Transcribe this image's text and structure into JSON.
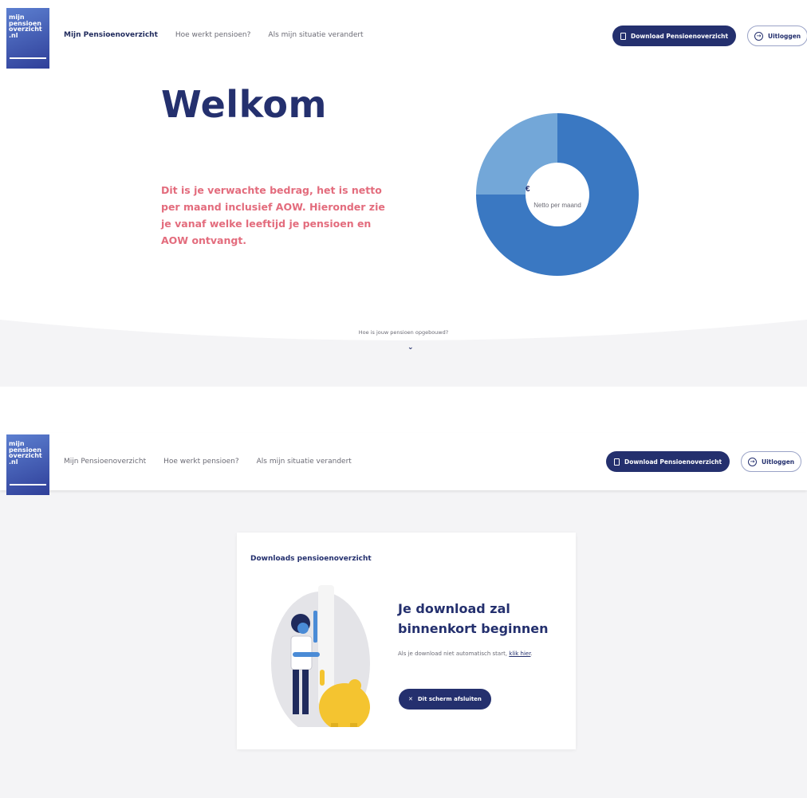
{
  "logo": {
    "lines": [
      "mijn",
      "pensioen",
      "overzicht",
      ".nl"
    ]
  },
  "nav": {
    "items": [
      "Mijn Pensioenoverzicht",
      "Hoe werkt pensioen?",
      "Als mijn situatie verandert"
    ]
  },
  "header": {
    "download_label": "Download Pensioenoverzicht",
    "logout_label": "Uitloggen"
  },
  "welcome": {
    "title": "Welkom",
    "intro": "Dit is je verwachte bedrag, het is netto per maand inclusief AOW. Hieronder zie je vanaf welke leeftijd je pensioen en AOW ontvangt.",
    "chart_currency": "€",
    "chart_label": "Netto per maand",
    "scroll_hint": "Hoe is jouw pensioen opgebouwd?"
  },
  "chart_data": {
    "type": "pie",
    "donut": true,
    "slices": [
      {
        "value": 75,
        "color": "#3a78c2"
      },
      {
        "value": 25,
        "color": "#73a7d8"
      }
    ]
  },
  "download": {
    "card_title": "Downloads pensioenoverzicht",
    "heading": "Je download zal binnenkort beginnen",
    "sub_text": "Als je download niet automatisch start,",
    "link_text": "klik hier",
    "sub_end": ".",
    "close_label": "Dit scherm afsluiten"
  },
  "colors": {
    "navy": "#24306e",
    "accent_pink": "#e36c7d",
    "donut_dark": "#3a78c2",
    "donut_light": "#73a7d8"
  }
}
